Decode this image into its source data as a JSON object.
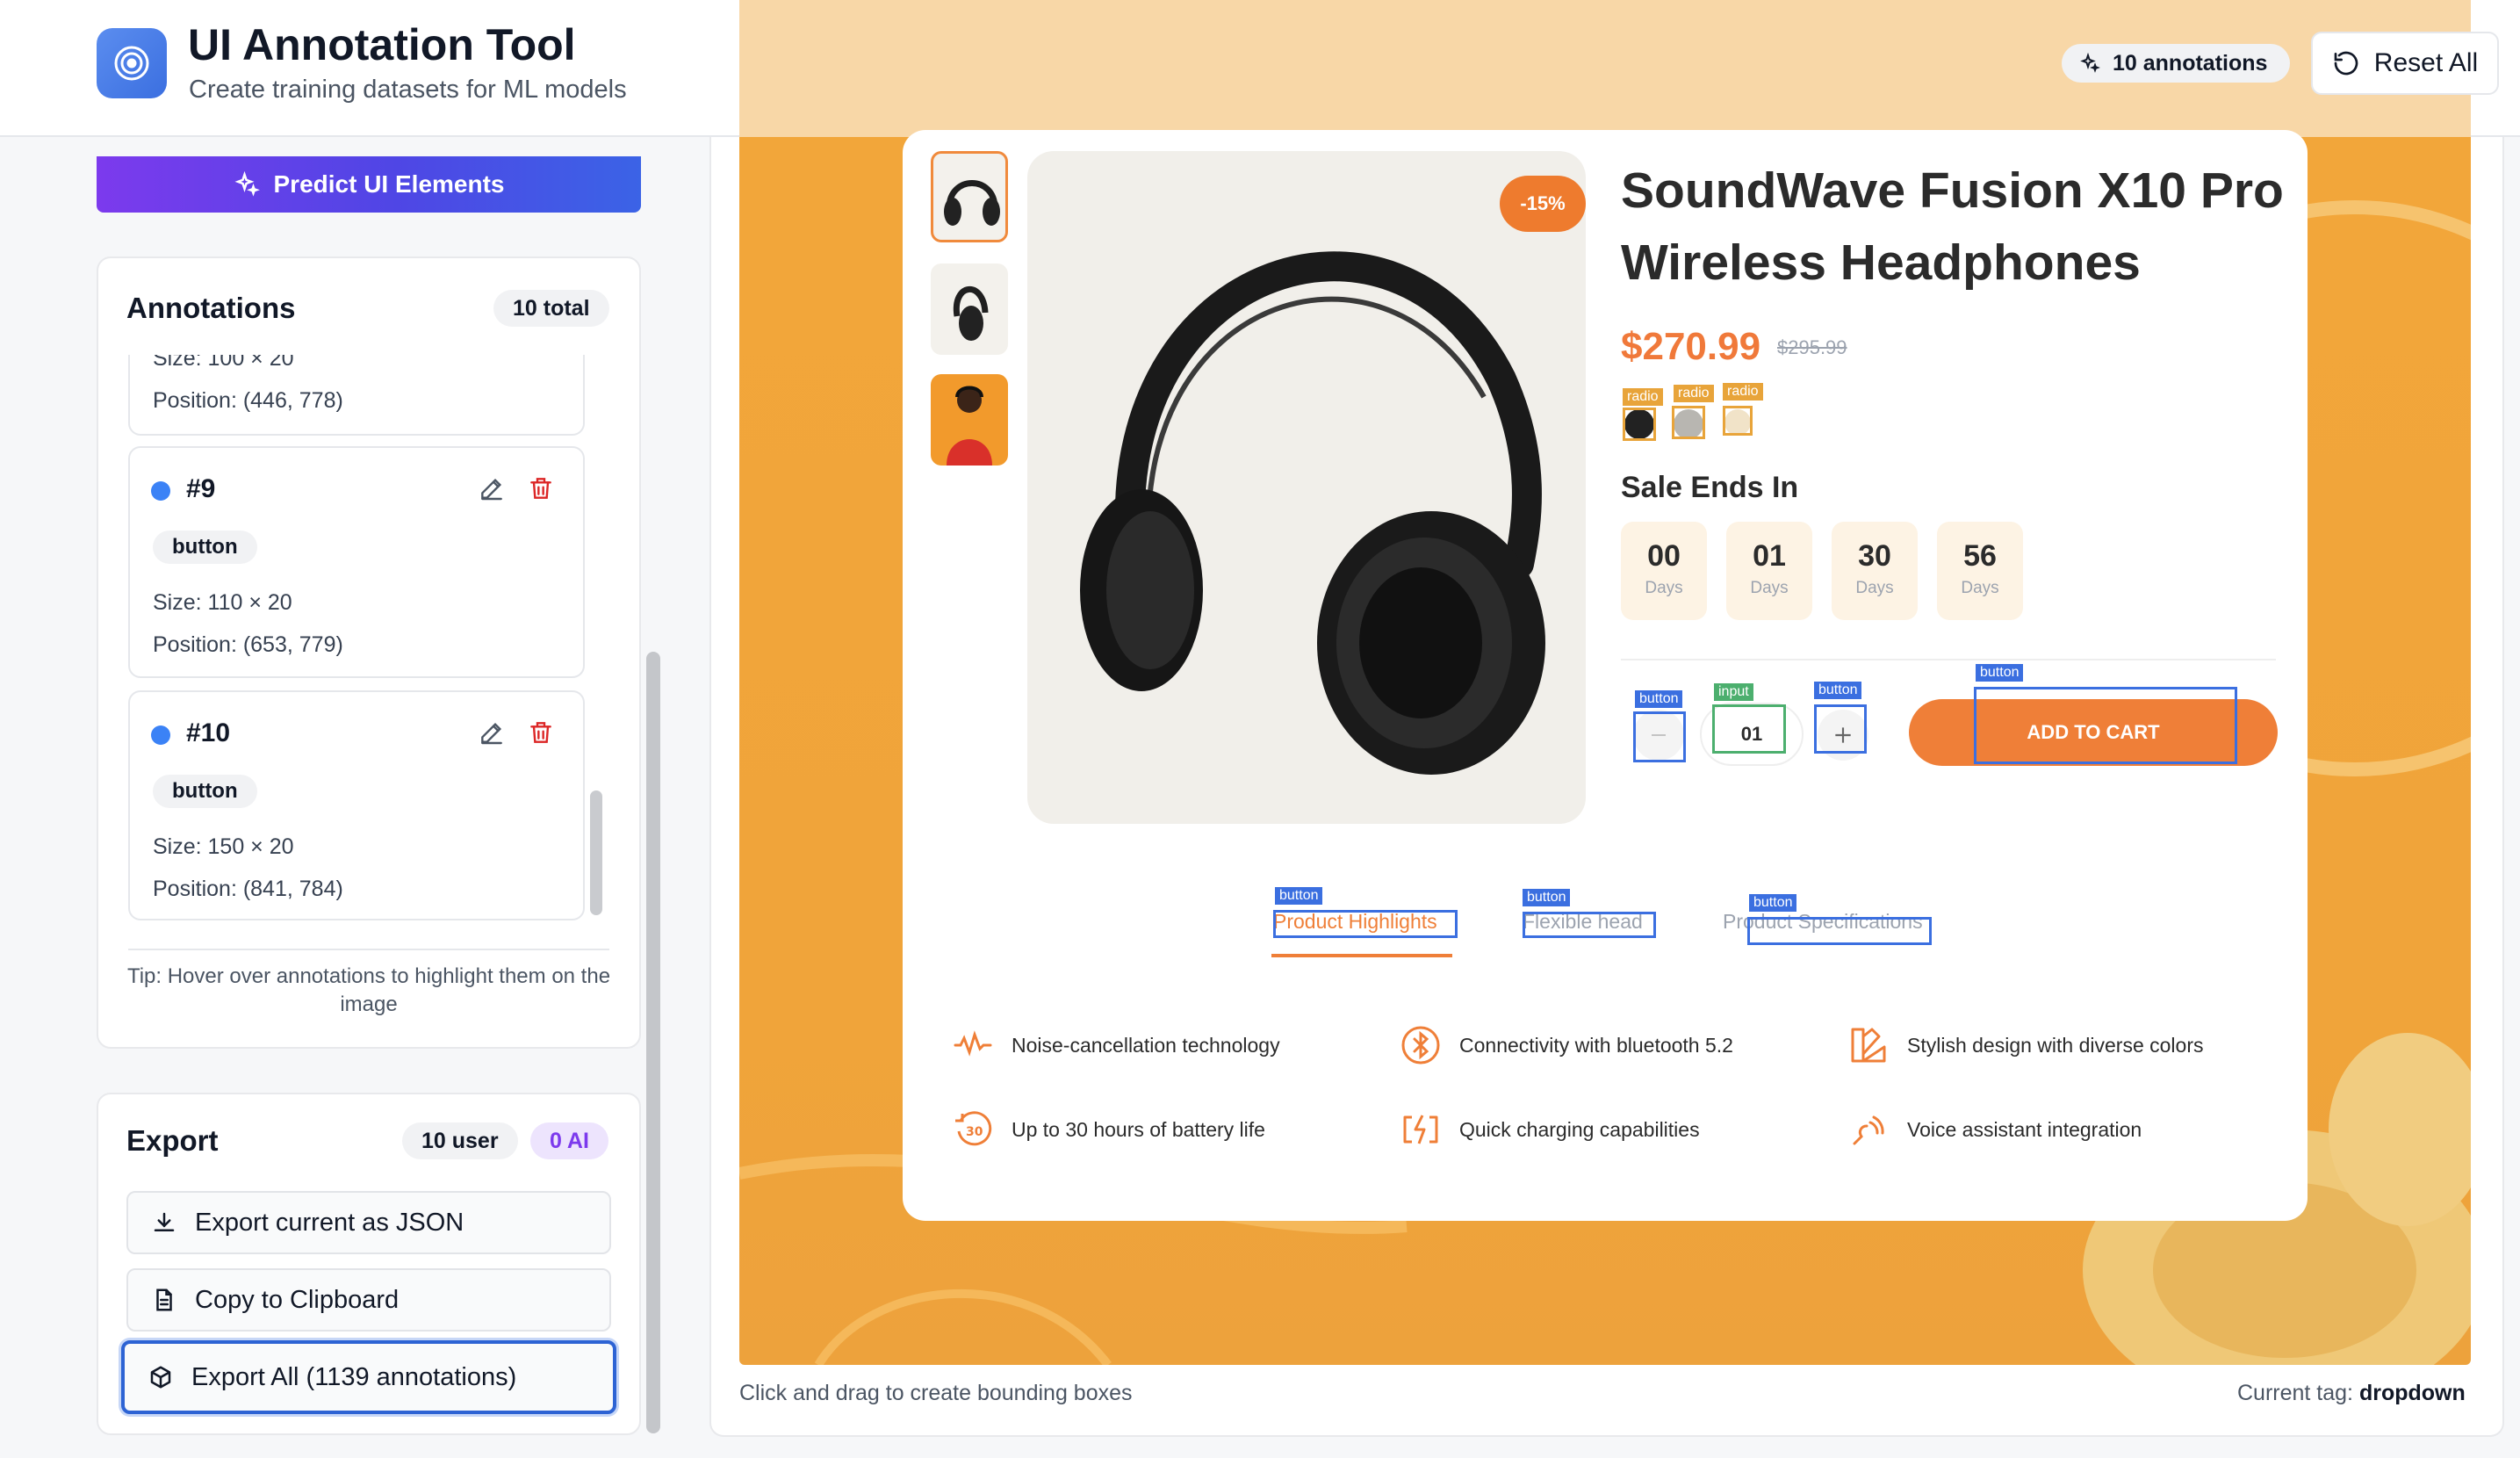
{
  "app": {
    "title": "UI Annotation Tool",
    "subtitle": "Create training datasets for ML models",
    "annotations_badge": "10 annotations",
    "reset_label": "Reset All"
  },
  "sidebar": {
    "predict_label": "Predict UI Elements",
    "annotations": {
      "heading": "Annotations",
      "total": "10 total",
      "cards": [
        {
          "size": "Size: 100 × 20",
          "position": "Position: (446, 778)"
        },
        {
          "id": "#9",
          "type": "button",
          "size": "Size: 110 × 20",
          "position": "Position: (653, 779)"
        },
        {
          "id": "#10",
          "type": "button",
          "size": "Size: 150 × 20",
          "position": "Position: (841, 784)"
        }
      ],
      "tip": "Tip: Hover over annotations to highlight them on the image"
    },
    "export": {
      "heading": "Export",
      "user_count": "10 user",
      "ai_count": "0 AI",
      "json_label": "Export current as JSON",
      "clipboard_label": "Copy to Clipboard",
      "all_label": "Export All (1139 annotations)"
    }
  },
  "canvas": {
    "hint": "Click and drag to create bounding boxes",
    "current_tag_label": "Current tag:",
    "current_tag_value": "dropdown"
  },
  "product": {
    "discount": "-15%",
    "title": "SoundWave Fusion X10 Pro Wireless Headphones",
    "price": "$270.99",
    "old_price": "$295.99",
    "sale_heading": "Sale Ends In",
    "countdown": [
      {
        "value": "00",
        "unit": "Days"
      },
      {
        "value": "01",
        "unit": "Days"
      },
      {
        "value": "30",
        "unit": "Days"
      },
      {
        "value": "56",
        "unit": "Days"
      }
    ],
    "quantity": "01",
    "add_to_cart": "ADD TO CART",
    "tabs": [
      "Product Highlights",
      "Flexible head",
      "Product Specifications"
    ],
    "features": [
      {
        "text": "Noise-cancellation technology",
        "icon": "ear-wave-icon"
      },
      {
        "text": "Connectivity with bluetooth 5.2",
        "icon": "bluetooth-icon"
      },
      {
        "text": "Stylish design with diverse colors",
        "icon": "palette-icon"
      },
      {
        "text": "Up to 30 hours of battery life",
        "icon": "battery-30-icon"
      },
      {
        "text": "Quick charging capabilities",
        "icon": "lightning-icon"
      },
      {
        "text": "Voice assistant integration",
        "icon": "voice-icon"
      }
    ]
  },
  "overlay_labels": {
    "radio": "radio",
    "button": "button",
    "input": "input"
  },
  "colors": {
    "accent": "#3b6fe0",
    "orange": "#ef7f38",
    "canvas_bg": "#f2a63a",
    "predict_gradient_start": "#7c3aed"
  }
}
